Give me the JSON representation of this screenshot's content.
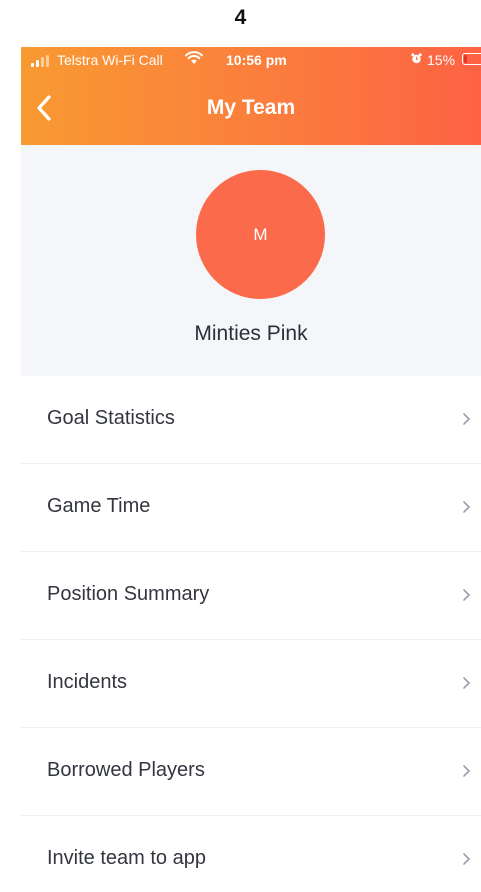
{
  "page_label": "4",
  "status_bar": {
    "carrier": "Telstra Wi-Fi Call",
    "time": "10:56 pm",
    "battery_percent": "15%",
    "battery_level": 0.15,
    "signal_bars": 2,
    "icons": [
      "signal-icon",
      "wifi-icon",
      "alarm-icon",
      "battery-icon"
    ]
  },
  "header": {
    "title": "My Team",
    "back_icon": "chevron-left-icon",
    "gradient_colors": [
      "#f89a32",
      "#fd6244"
    ]
  },
  "profile": {
    "avatar_initial": "M",
    "avatar_color": "#fb6a4a",
    "team_name": "Minties Pink"
  },
  "menu": {
    "chevron_icon": "chevron-right-icon",
    "items": [
      {
        "label": "Goal Statistics"
      },
      {
        "label": "Game Time"
      },
      {
        "label": "Position Summary"
      },
      {
        "label": "Incidents"
      },
      {
        "label": "Borrowed Players"
      },
      {
        "label": "Invite team to app"
      }
    ]
  }
}
